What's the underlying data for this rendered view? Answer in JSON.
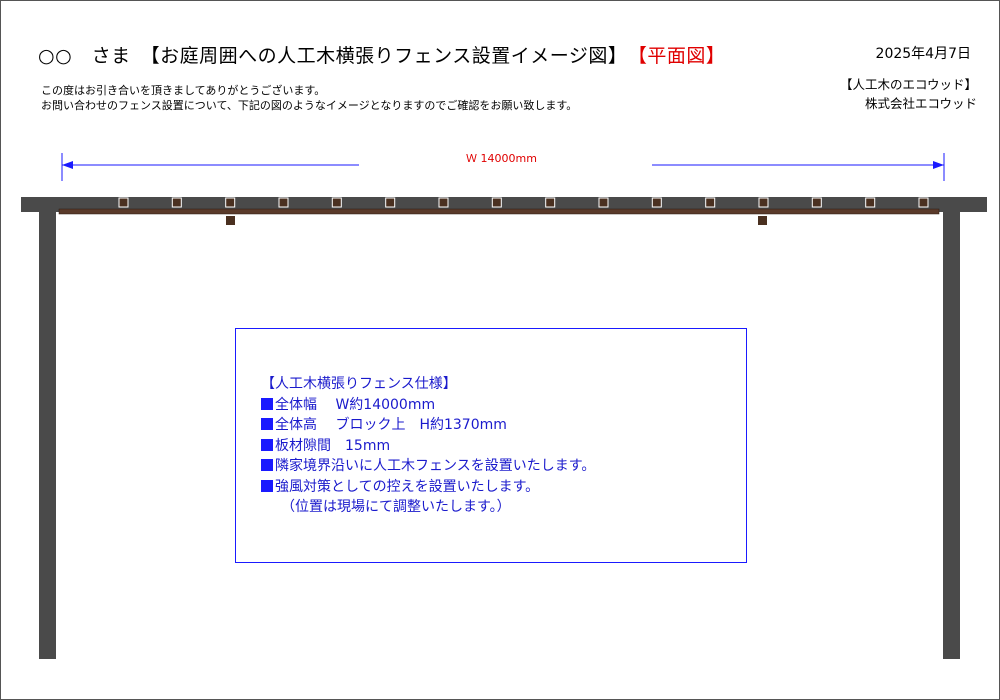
{
  "header": {
    "title_main": "○○　さま　【お庭周囲への人工木横張りフェンス設置イメージ図】",
    "title_plan": "【平面図】",
    "date": "2025年4月7日"
  },
  "intro": {
    "line1": "この度はお引き合いを頂きましてありがとうございます。",
    "line2": "お問い合わせのフェンス設置について、下記の図のようなイメージとなりますのでご確認をお願い致します。"
  },
  "company": {
    "brand": "【人工木のエコウッド】",
    "name": "株式会社エコウッド"
  },
  "dimension": {
    "label": "Ｗ 14000mm"
  },
  "spec": {
    "heading": "【人工木横張りフェンス仕様】",
    "items": [
      "全体幅　 W約14000mm",
      "全体高　 ブロック上　H約1370mm",
      "板材隙間　15mm",
      "隣家境界沿いに人工木フェンスを設置いたします。",
      "強風対策としての控えを設置いたします。"
    ],
    "note": "（位置は現場にて調整いたします。）"
  },
  "colors": {
    "wall": "#4a4a4a",
    "board": "#5a3a2a",
    "post": "#4a3020",
    "dimension_line": "#1a1aff",
    "accent_red": "#e00000"
  }
}
